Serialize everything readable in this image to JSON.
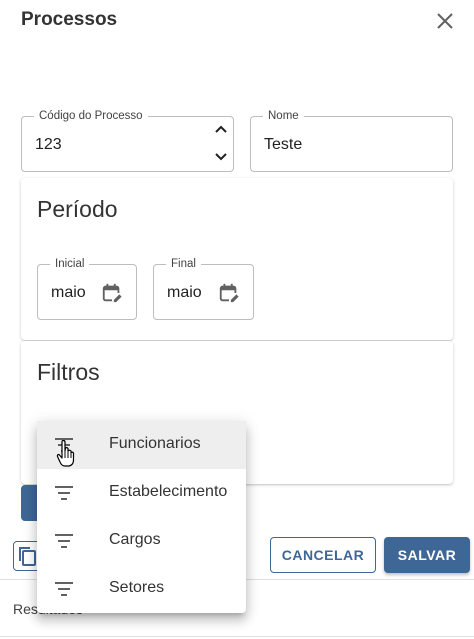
{
  "header": {
    "title": "Processos",
    "close_icon": "close-icon"
  },
  "form": {
    "codigo": {
      "label": "Código do Processo",
      "value": "123"
    },
    "nome": {
      "label": "Nome",
      "value": "Teste"
    }
  },
  "periodo": {
    "title": "Período",
    "inicial": {
      "label": "Inicial",
      "value": "maio"
    },
    "final": {
      "label": "Final",
      "value": "maio"
    }
  },
  "filtros": {
    "title": "Filtros"
  },
  "menu": {
    "items": [
      {
        "label": "Funcionarios",
        "icon": "filter-icon",
        "hovered": true
      },
      {
        "label": "Estabelecimento",
        "icon": "filter-icon"
      },
      {
        "label": "Cargos",
        "icon": "filter-icon"
      },
      {
        "label": "Setores",
        "icon": "filter-icon"
      }
    ]
  },
  "actions": {
    "cancel_label": "CANCELAR",
    "save_label": "SALVAR"
  },
  "footer": {
    "results_label": "Resultados"
  },
  "colors": {
    "primary": "#3f6796",
    "text": "#212121",
    "border": "#bdbdbd",
    "hover": "#eeeeee"
  }
}
